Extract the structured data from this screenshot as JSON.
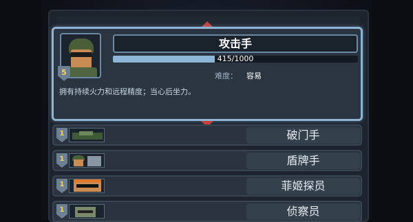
{
  "selected": {
    "name": "攻击手",
    "level": "5",
    "xp_text": "415/1000",
    "xp_progress": 0.415,
    "difficulty_label": "难度：",
    "difficulty_value": "容易",
    "description": "拥有持续火力和远程精度；当心后坐力。"
  },
  "ghost_title": "攻击手",
  "list": [
    {
      "level": "1",
      "name": "破门手"
    },
    {
      "level": "1",
      "name": "盾牌手"
    },
    {
      "level": "1",
      "name": "菲姬探员"
    },
    {
      "level": "1",
      "name": "侦察员"
    }
  ],
  "colors": {
    "accent": "#8db6d6",
    "arrow": "#c8403a",
    "level_text": "#f4d35e"
  }
}
